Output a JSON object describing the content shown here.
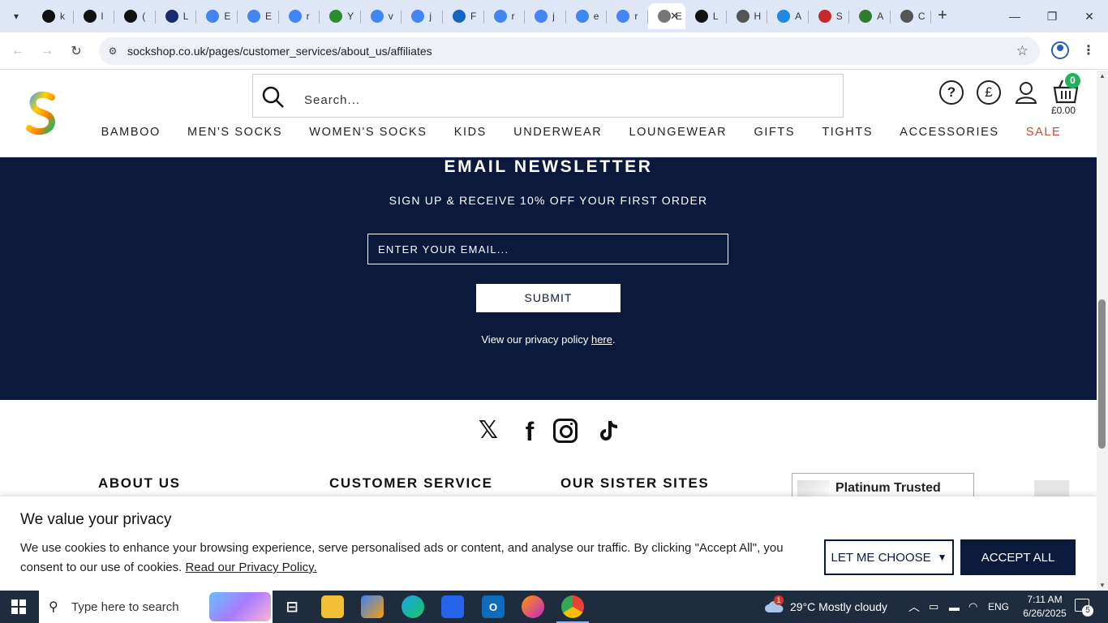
{
  "browser": {
    "tabs": [
      {
        "icon": "chatgpt-icon",
        "title": "k",
        "color": "#111111"
      },
      {
        "icon": "chatgpt-icon",
        "title": "l",
        "color": "#111111"
      },
      {
        "icon": "bold-b-icon",
        "title": "(",
        "color": "#111111"
      },
      {
        "icon": "ttp-icon",
        "title": "L",
        "color": "#1a2a6e"
      },
      {
        "icon": "google-icon",
        "title": "E",
        "color": "#4285f4"
      },
      {
        "icon": "google-icon",
        "title": "E",
        "color": "#4285f4"
      },
      {
        "icon": "google-icon",
        "title": "r",
        "color": "#4285f4"
      },
      {
        "icon": "green-globe-icon",
        "title": "Y",
        "color": "#2e8b2e"
      },
      {
        "icon": "google-icon",
        "title": "v",
        "color": "#4285f4"
      },
      {
        "icon": "google-icon",
        "title": "j",
        "color": "#4285f4"
      },
      {
        "icon": "xf-icon",
        "title": "F",
        "color": "#1565c0"
      },
      {
        "icon": "google-icon",
        "title": "r",
        "color": "#4285f4"
      },
      {
        "icon": "google-icon",
        "title": "j",
        "color": "#4285f4"
      },
      {
        "icon": "google-icon",
        "title": "e",
        "color": "#4285f4"
      },
      {
        "icon": "google-icon",
        "title": "r",
        "color": "#4285f4"
      },
      {
        "icon": "sockshop-icon",
        "title": "E",
        "color": "#777777",
        "active": true
      },
      {
        "icon": "paypal-icon",
        "title": "L",
        "color": "#111111"
      },
      {
        "icon": "globe-icon",
        "title": "H",
        "color": "#555555"
      },
      {
        "icon": "blue-circle-icon",
        "title": "A",
        "color": "#1e88e5"
      },
      {
        "icon": "star-badge-icon",
        "title": "S",
        "color": "#c62828"
      },
      {
        "icon": "green-s-icon",
        "title": "A",
        "color": "#2e7d32"
      },
      {
        "icon": "globe-icon",
        "title": "C",
        "color": "#555555"
      }
    ],
    "url": "sockshop.co.uk/pages/customer_services/about_us/affiliates"
  },
  "header": {
    "search_placeholder": "Search...",
    "help_glyph": "?",
    "currency_glyph": "£",
    "basket_count": "0",
    "basket_total": "£0.00",
    "nav": [
      "BAMBOO",
      "MEN'S SOCKS",
      "WOMEN'S SOCKS",
      "KIDS",
      "UNDERWEAR",
      "LOUNGEWEAR",
      "GIFTS",
      "TIGHTS",
      "ACCESSORIES",
      "SALE"
    ],
    "sale_color": "#c94b2a"
  },
  "newsletter": {
    "title": "EMAIL NEWSLETTER",
    "subtitle": "SIGN UP & RECEIVE 10% OFF YOUR FIRST ORDER",
    "email_placeholder": "ENTER YOUR EMAIL...",
    "submit_label": "SUBMIT",
    "privacy_prefix": "View our privacy policy ",
    "privacy_link": "here",
    "privacy_suffix": ".",
    "background": "#0b1a3c"
  },
  "socials": {
    "x_glyph": "𝕏",
    "facebook_glyph": "f"
  },
  "footer": {
    "about_heading": "ABOUT US",
    "service_heading": "CUSTOMER SERVICE",
    "sister_heading": "OUR SISTER SITES",
    "trust_badge": "Platinum Trusted"
  },
  "cookie": {
    "title": "We value your privacy",
    "text": "We use cookies to enhance your browsing experience, serve personalised ads or content, and analyse our traffic. By clicking \"Accept All\", you consent to our use of cookies. ",
    "link": "Read our Privacy Policy.",
    "choose_label": "LET ME CHOOSE",
    "accept_label": "ACCEPT ALL"
  },
  "taskbar": {
    "search_placeholder": "Type here to search",
    "weather_badge": "1",
    "weather": "29°C  Mostly cloudy",
    "language": "ENG",
    "time": "7:11 AM",
    "date": "6/26/2025",
    "notification_count": "5"
  }
}
